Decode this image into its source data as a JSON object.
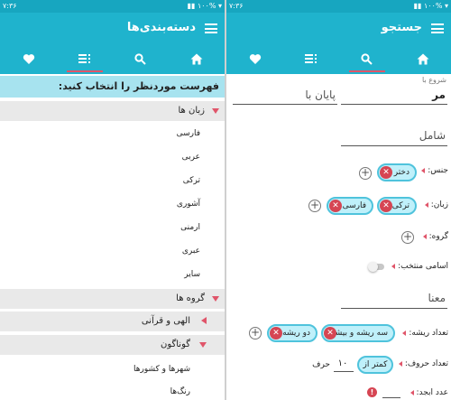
{
  "left": {
    "status": {
      "time": "۷:۳۶",
      "icons": "▮▮ ۱۰۰% ▾"
    },
    "title": "دسته‌بندی‌ها",
    "tabs": [
      {
        "id": "favorites",
        "icon": "heart-icon"
      },
      {
        "id": "categories",
        "icon": "list-icon",
        "active": true
      },
      {
        "id": "search",
        "icon": "search-icon"
      },
      {
        "id": "home",
        "icon": "home-icon"
      }
    ],
    "header": "فهرست موردنظر را انتخاب کنید:",
    "groups": [
      {
        "label": "زبان ها",
        "expanded": true,
        "items": [
          "فارسی",
          "عربی",
          "ترکی",
          "آشوری",
          "ارمنی",
          "عبری",
          "سایر"
        ]
      },
      {
        "label": "گروه ها",
        "expanded": true,
        "subgroups": [
          {
            "label": "الهی و قرآنی",
            "expanded": false
          },
          {
            "label": "گوناگون",
            "expanded": true,
            "items": [
              "شهرها و کشورها",
              "رنگ‌ها"
            ]
          }
        ]
      }
    ]
  },
  "right": {
    "status": {
      "time": "۷:۳۶",
      "icons": "▮▮ ۱۰۰% ▾"
    },
    "title": "جستجو",
    "tabs": [
      {
        "id": "favorites",
        "icon": "heart-icon"
      },
      {
        "id": "categories",
        "icon": "list-icon"
      },
      {
        "id": "search",
        "icon": "search-icon",
        "active": true
      },
      {
        "id": "home",
        "icon": "home-icon"
      }
    ],
    "starts_with": {
      "label": "شروع با",
      "value": "مر"
    },
    "ends_with": {
      "placeholder": "پایان با"
    },
    "contains": {
      "placeholder": "شامل"
    },
    "gender": {
      "label": "جنس:",
      "chips": [
        "دختر"
      ]
    },
    "language": {
      "label": "زبان:",
      "chips": [
        "ترکی",
        "فارسی"
      ]
    },
    "group": {
      "label": "گروه:"
    },
    "selected_names": {
      "label": "اسامی منتخب:",
      "on": false
    },
    "meaning": {
      "placeholder": "معنا"
    },
    "root_count": {
      "label": "تعداد ریشه:",
      "chips": [
        "سه ریشه و بیشتر",
        "دو ریشه"
      ]
    },
    "letter_count": {
      "label": "تعداد حروف:",
      "op": "کمتر از",
      "value": "۱۰",
      "unit": "حرف"
    },
    "abjad": {
      "label": "عدد ابجد:"
    }
  },
  "colors": {
    "primary": "#1fb3cd",
    "accent": "#e0556a",
    "chip_bg": "#bff0fa",
    "header_bg": "#a7e3ef"
  }
}
